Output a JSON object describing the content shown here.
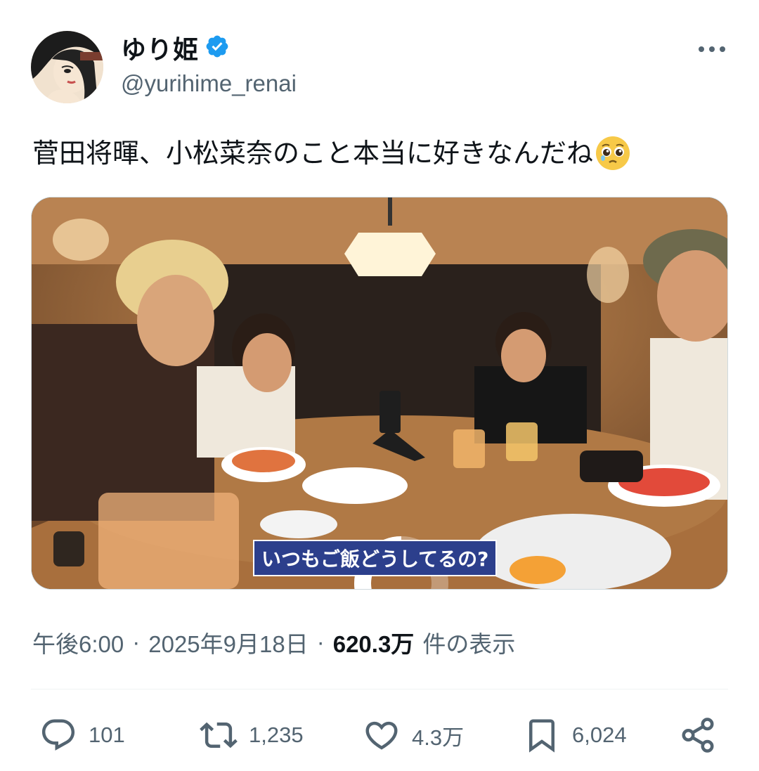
{
  "author": {
    "display_name": "ゆり姫",
    "handle": "@yurihime_renai",
    "verified_icon": "verified-badge-icon",
    "avatar": "illustrated-woman-avatar"
  },
  "more_icon": "more-horizontal-icon",
  "tweet": {
    "text": "菅田将暉、小松菜奈のこと本当に好きなんだね",
    "emoji": "pleading-face-emoji"
  },
  "media": {
    "subtitle": "いつもご飯どうしてるの?",
    "loading_icon": "loading-spinner-icon"
  },
  "meta": {
    "time": "午後6:00",
    "separator": "·",
    "date": "2025年9月18日",
    "views_count": "620.3万",
    "views_label": "件の表示"
  },
  "actions": {
    "reply": {
      "icon": "reply-icon",
      "count": "101"
    },
    "retweet": {
      "icon": "retweet-icon",
      "count": "1,235"
    },
    "like": {
      "icon": "heart-icon",
      "count": "4.3万"
    },
    "bookmark": {
      "icon": "bookmark-icon",
      "count": "6,024"
    },
    "share": {
      "icon": "share-icon"
    }
  },
  "colors": {
    "verified": "#1d9bf0",
    "secondary_text": "#536471",
    "subtitle_bg": "#2c3f8c"
  }
}
